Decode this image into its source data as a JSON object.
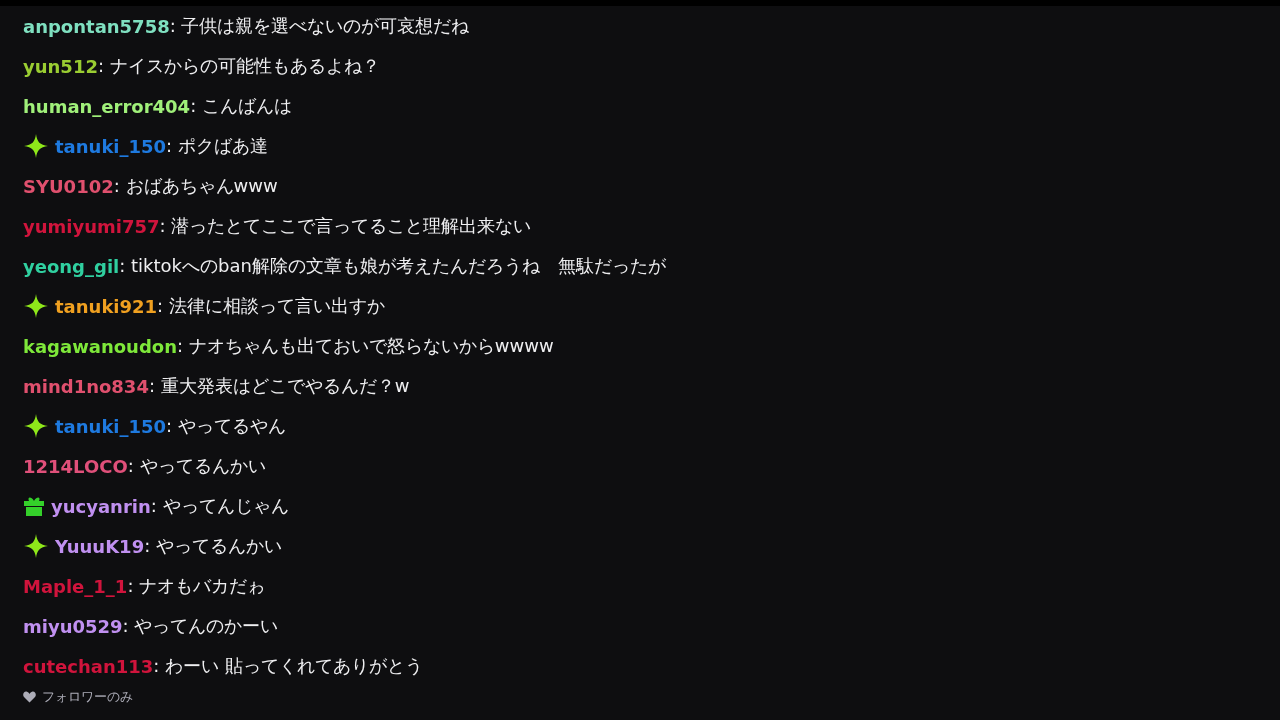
{
  "messages": [
    {
      "kind": "plain",
      "user": "anpontan5758",
      "color": "#7fe0c0",
      "message": ": 子供は親を選べないのが可哀想だね"
    },
    {
      "kind": "plain",
      "user": "yun512",
      "color": "#9acd32",
      "message": ": ナイスからの可能性もあるよね？"
    },
    {
      "kind": "plain",
      "user": "human_error404",
      "color": "#a0f07a",
      "message": ": こんばんは"
    },
    {
      "kind": "sparkle",
      "user": "tanuki_150",
      "color": "#1e7ae0",
      "message": ": ポクばあ達"
    },
    {
      "kind": "plain",
      "user": "SYU0102",
      "color": "#e0506e",
      "message": ": おばあちゃんwww"
    },
    {
      "kind": "plain",
      "user": "yumiyumi757",
      "color": "#d0143c",
      "message": ": 潜ったとてここで言ってること理解出来ない"
    },
    {
      "kind": "plain",
      "user": "yeong_gil",
      "color": "#30d0a0",
      "message": ": tiktokへのban解除の文章も娘が考えたんだろうね　無駄だったが"
    },
    {
      "kind": "sparkle",
      "user": "tanuki921",
      "color": "#f0a020",
      "message": ": 法律に相談って言い出すか"
    },
    {
      "kind": "plain",
      "user": "kagawanoudon",
      "color": "#7ee83a",
      "message": ": ナオちゃんも出ておいで怒らないからwwww"
    },
    {
      "kind": "plain",
      "user": "mind1no834",
      "color": "#e0506e",
      "message": ": 重大発表はどこでやるんだ？w"
    },
    {
      "kind": "sparkle",
      "user": "tanuki_150",
      "color": "#1e7ae0",
      "message": ": やってるやん"
    },
    {
      "kind": "plain",
      "user": "1214LOCO",
      "color": "#e0507a",
      "message": ": やってるんかい"
    },
    {
      "kind": "gift",
      "user": "yucyanrin",
      "color": "#c090f0",
      "message": ": やってんじゃん"
    },
    {
      "kind": "sparkle",
      "user": "YuuuK19",
      "color": "#c090f0",
      "message": ": やってるんかい"
    },
    {
      "kind": "plain",
      "user": "Maple_1_1",
      "color": "#d0143c",
      "message": ": ナオもバカだゎ"
    },
    {
      "kind": "plain",
      "user": "miyu0529",
      "color": "#c090f0",
      "message": ": やってんのかーい"
    },
    {
      "kind": "plain",
      "user": "cutechan113",
      "color": "#d0143c",
      "message": ": わーい 貼ってくれてありがとう"
    }
  ],
  "footer": {
    "label": "フォロワーのみ"
  }
}
